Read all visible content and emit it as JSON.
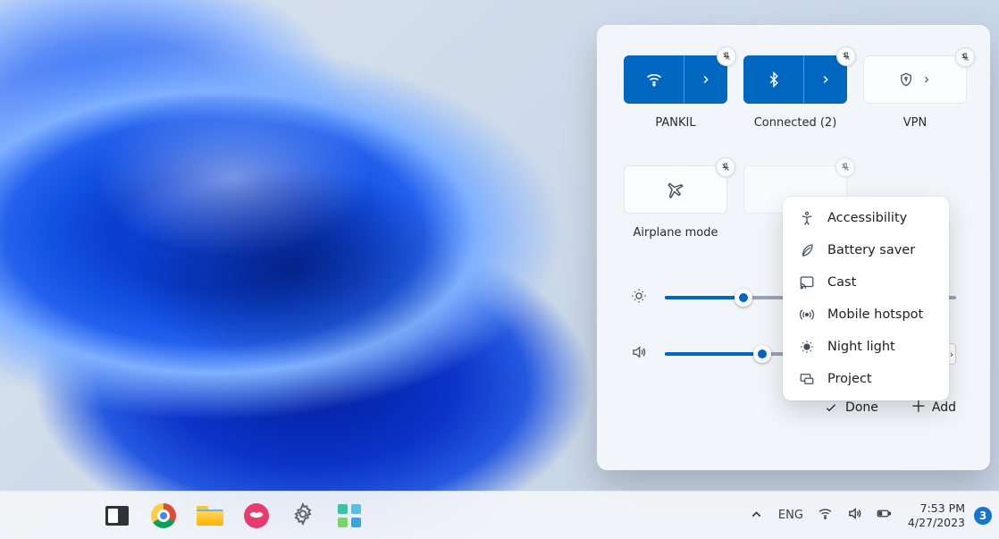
{
  "quick_settings": {
    "tiles": {
      "wifi": {
        "label": "PANKIL",
        "active": true,
        "icon": "wifi-icon"
      },
      "bluetooth": {
        "label": "Connected (2)",
        "active": true,
        "icon": "bluetooth-icon"
      },
      "vpn": {
        "label": "VPN",
        "active": false,
        "icon": "vpn-shield-icon"
      },
      "airplane": {
        "label": "Airplane mode",
        "active": false,
        "icon": "airplane-icon"
      }
    },
    "sliders": {
      "brightness_percent": 27,
      "volume_percent": 39
    },
    "footer": {
      "done_label": "Done",
      "add_label": "Add"
    },
    "add_menu": [
      {
        "icon": "accessibility-icon",
        "label": "Accessibility"
      },
      {
        "icon": "leaf-icon",
        "label": "Battery saver"
      },
      {
        "icon": "cast-icon",
        "label": "Cast"
      },
      {
        "icon": "hotspot-icon",
        "label": "Mobile hotspot"
      },
      {
        "icon": "nightlight-icon",
        "label": "Night light"
      },
      {
        "icon": "project-icon",
        "label": "Project"
      }
    ]
  },
  "taskbar": {
    "ime": "ENG",
    "time": "7:53 PM",
    "date": "4/27/2023",
    "notification_count": "3"
  }
}
